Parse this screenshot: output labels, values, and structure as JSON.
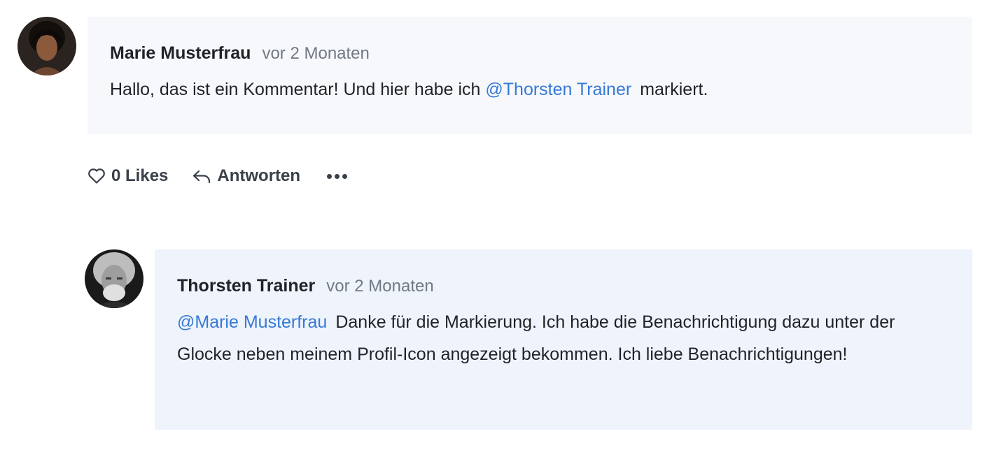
{
  "comment": {
    "author": "Marie Musterfrau",
    "time": "vor 2 Monaten",
    "text_before": "Hallo, das ist ein Kommentar! Und hier habe ich ",
    "mention": "@Thorsten Trainer",
    "text_after": "markiert.",
    "avatar_icon": "user-avatar-icon"
  },
  "actions": {
    "likes_label": "0 Likes",
    "reply_label": "Antworten",
    "like_icon": "heart-outline-icon",
    "reply_icon": "reply-arrow-icon",
    "more_icon": "more-dots-icon"
  },
  "reply": {
    "author": "Thorsten Trainer",
    "time": "vor 2 Monaten",
    "mention": "@Marie Musterfrau",
    "text": "Danke für die Markierung. Ich habe die Benachrichtigung dazu unter der Glocke neben meinem Profil-Icon angezeigt bekommen. Ich liebe Benachrichtigungen!",
    "avatar_icon": "user-avatar-icon"
  },
  "colors": {
    "mention": "#3579d6",
    "comment_bg": "#f7f8fb",
    "reply_bg": "#eff3fb",
    "muted_text": "#717985"
  }
}
